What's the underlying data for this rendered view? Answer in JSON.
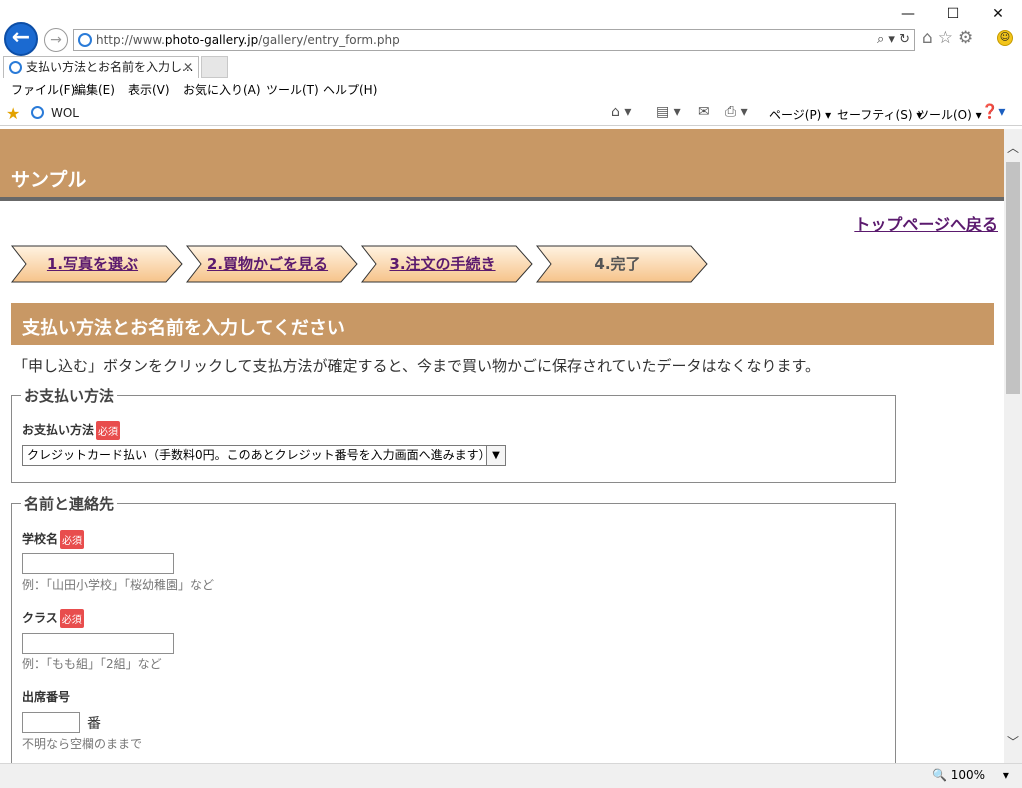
{
  "window": {
    "minimize": "—",
    "maximize": "☐",
    "close": "✕"
  },
  "browser": {
    "url_prefix": "http://www.",
    "url_domain": "photo-gallery.jp",
    "url_path": "/gallery/entry_form.php",
    "tab_title": "支払い方法とお名前を入力し...",
    "tab_close": "✕",
    "menu": [
      "ファイル(F)",
      "編集(E)",
      "表示(V)",
      "お気に入り(A)",
      "ツール(T)",
      "ヘルプ(H)"
    ],
    "favorites_item": "WOL",
    "commands": {
      "page": "ページ(P) ▾",
      "safety": "セーフティ(S) ▾",
      "tools": "ツール(O) ▾"
    },
    "zoom": "100%"
  },
  "site": {
    "header_title": "サンプル",
    "top_link": "トップページへ戻る",
    "steps": [
      {
        "label": "1.写真を選ぶ",
        "state": "link"
      },
      {
        "label": "2.買物かごを見る",
        "state": "link"
      },
      {
        "label": "3.注文の手続き",
        "state": "link"
      },
      {
        "label": "4.完了",
        "state": "current"
      }
    ],
    "section_title": "支払い方法とお名前を入力してください",
    "notice": "「申し込む」ボタンをクリックして支払方法が確定すると、今まで買い物かごに保存されていたデータはなくなります。",
    "required_badge": "必須",
    "payment": {
      "legend": "お支払い方法",
      "label": "お支払い方法",
      "selected": "クレジットカード払い（手数料0円。このあとクレジット番号を入力画面へ進みます）"
    },
    "contact": {
      "legend": "名前と連絡先",
      "school": {
        "label": "学校名",
        "value": "",
        "hint": "例：「山田小学校」「桜幼稚園」など"
      },
      "class": {
        "label": "クラス",
        "value": "",
        "hint": "例：「もも組」「2組」など"
      },
      "seat": {
        "label": "出席番号",
        "value": "",
        "unit": "番",
        "hint": "不明なら空欄のままで"
      }
    }
  }
}
